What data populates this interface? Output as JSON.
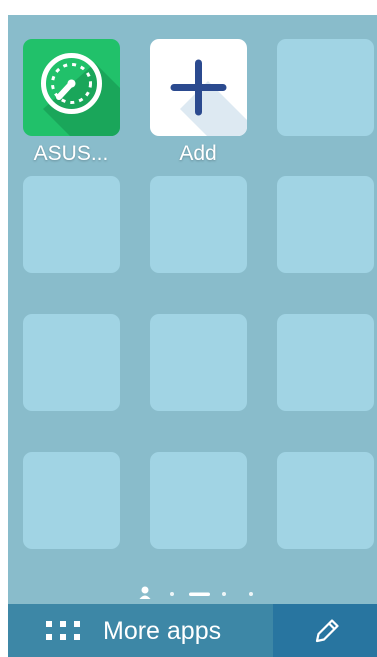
{
  "apps": [
    {
      "name": "ASUS...",
      "icon": "speedometer-icon",
      "color": "#21c16a"
    },
    {
      "name": "Add",
      "icon": "plus-icon",
      "color": "#ffffff",
      "glyph_color": "#2b4a8f"
    }
  ],
  "empty_slots": 10,
  "page_indicator": {
    "pages": 5,
    "current_page": 3,
    "first_page_icon": "person-icon"
  },
  "bottom_bar": {
    "more_apps_label": "More apps",
    "more_apps_icon": "grid-icon",
    "edit_icon": "pencil-icon"
  },
  "colors": {
    "background": "#89bccb",
    "tile": "#a1d4e4",
    "bar_left": "#3d87a6",
    "bar_right": "#2875a0"
  }
}
